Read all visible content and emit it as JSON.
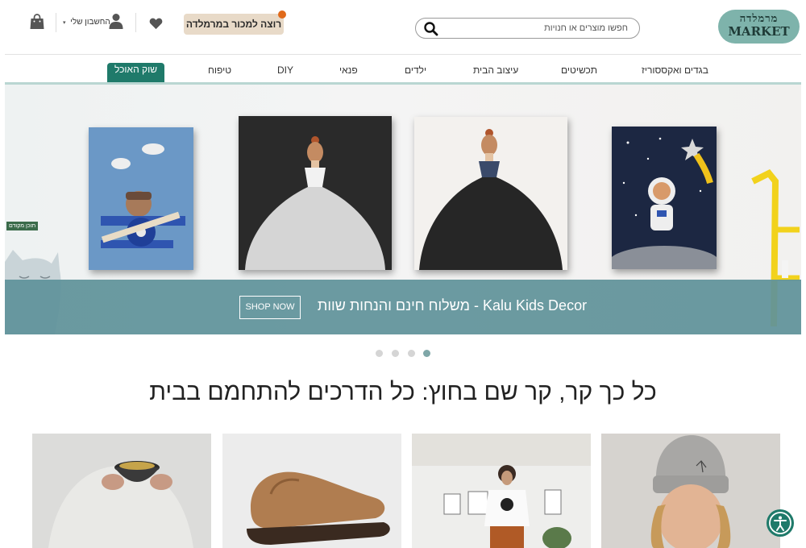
{
  "header": {
    "logo_line1": "מרמלדה",
    "logo_line2": "MARKET",
    "search_placeholder": "חפשו מוצרים או חנויות",
    "sell_button": "רוצה למכור במרמלדה",
    "account_label": "החשבון שלי",
    "caret": "▾"
  },
  "nav": {
    "items": [
      "בגדים ואקססוריז",
      "תכשיטים",
      "עיצוב הבית",
      "ילדים",
      "פנאי",
      "DIY",
      "טיפוח",
      "שוק האוכל"
    ]
  },
  "hero": {
    "title": "Kalu Kids Decor - משלוח חינם והנחות שוות",
    "cta": "SHOP NOW",
    "side_tag": "תוכן מקודם",
    "slides_count": 4,
    "active_slide": 4
  },
  "section": {
    "title": "כל כך קר, קר שם בחוץ: כל הדרכים להתחמם בבית"
  },
  "colors": {
    "brand": "#7eb3ab",
    "accent": "#1f7a6a",
    "band": "#60929a",
    "sell_bg": "#e8dac8",
    "notification": "#e06a1b"
  },
  "icons": [
    "search-icon",
    "heart-icon",
    "user-icon",
    "shopping-bag-icon",
    "accessibility-icon"
  ]
}
